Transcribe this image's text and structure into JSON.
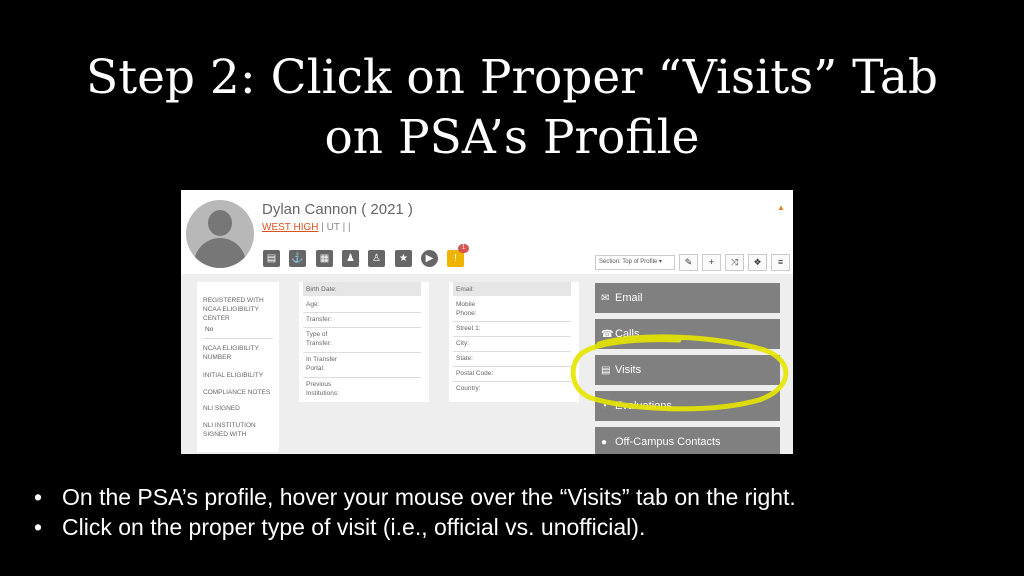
{
  "slide": {
    "title_line1": "Step 2: Click on Proper “Visits” Tab",
    "title_line2": "on PSA’s Profile",
    "bullets": [
      "On the PSA’s profile, hover your mouse over the “Visits” tab on the right.",
      "Click on the proper type of visit (i.e., official vs. unofficial)."
    ],
    "bullet_symbol": "•"
  },
  "profile": {
    "name": "Dylan Cannon ( 2021 )",
    "school": "WEST HIGH",
    "sub_rest": " | UT | |",
    "alert_count": "1",
    "section_select": "Section: Top of Profile ▾",
    "icons": [
      "document-icon",
      "anchor-icon",
      "id-card-icon",
      "group-icon",
      "person-icon",
      "trophy-icon",
      "play-icon",
      "warning-icon"
    ],
    "tool_icons": [
      "✎",
      "+",
      "⤨",
      "❖",
      "≡"
    ]
  },
  "compliance": {
    "rows": [
      "REGISTERED WITH",
      "NCAA ELIGIBILITY",
      "CENTER",
      "No",
      "NCAA ELIGIBILITY",
      "NUMBER",
      "INITIAL ELIGIBILITY",
      "COMPLIANCE NOTES",
      "NLI SIGNED",
      "NLI INSTITUTION",
      "SIGNED WITH"
    ]
  },
  "personal": {
    "fields": [
      "Birth Date:",
      "Age:",
      "Transfer:",
      "Type of",
      "Transfer:",
      "In Transfer",
      "Portal:",
      "Previous",
      "Institutions:"
    ]
  },
  "contact": {
    "fields": [
      "Email:",
      "Mobile",
      "Phone:",
      "Street 1:",
      "City:",
      "State:",
      "Postal Code:",
      "Country:"
    ]
  },
  "tabs": [
    {
      "icon": "✉",
      "label": "Email"
    },
    {
      "icon": "☎",
      "label": "Calls"
    },
    {
      "icon": "▤",
      "label": "Visits"
    },
    {
      "icon": "◔",
      "label": "Evaluations"
    },
    {
      "icon": "●",
      "label": "Off-Campus Contacts"
    }
  ],
  "colors": {
    "tab_bg": "#808080",
    "highlight": "#e6e600",
    "school_link": "#d9531e"
  }
}
